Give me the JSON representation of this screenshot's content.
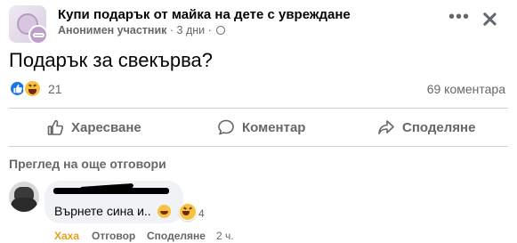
{
  "post": {
    "group_name": "Купи подарък от майка на дете с увреждане",
    "author": "Анонимен участник",
    "separator": "·",
    "time": "3 дни",
    "time_separator": "·",
    "more_glyph": "•••",
    "text": "Подарък за свекърва?"
  },
  "reactions": {
    "count": "21",
    "comments": "69 коментара",
    "icons": [
      "like-icon",
      "haha-icon"
    ]
  },
  "actions": {
    "like": "Харесване",
    "comment": "Коментар",
    "share": "Споделяне"
  },
  "comments_section": {
    "more_replies": "Преглед на още отговори",
    "comment": {
      "text": "Върнете сина и..",
      "reaction_count": "4",
      "haha_label": "Хаха",
      "reply_label": "Отговор",
      "share_label": "Споделяне",
      "time": "2 ч."
    }
  },
  "colors": {
    "accent": "#1b74e4",
    "haha": "#f7c13f",
    "secondary_text": "#65676b",
    "bubble": "#f0f2f5"
  }
}
